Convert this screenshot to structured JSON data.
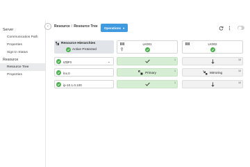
{
  "sidebar": {
    "groups": [
      {
        "label": "Server",
        "items": [
          {
            "label": "Communication Path"
          },
          {
            "label": "Properties"
          },
          {
            "label": "Sign-in Status"
          }
        ]
      },
      {
        "label": "Resource",
        "items": [
          {
            "label": "Resource Tree"
          },
          {
            "label": "Properties"
          }
        ]
      }
    ],
    "collapse_glyph": "‹"
  },
  "topbar": {
    "breadcrumb": [
      "Resource",
      "Resource Tree"
    ],
    "breadcrumb_sep": "/",
    "operations_label": "Operations",
    "operations_caret": "▾"
  },
  "hierarchy": {
    "title": "Resource Hierarchies",
    "status": "Active Protected"
  },
  "nodes": [
    {
      "name": "LK001",
      "extra": ""
    },
    {
      "name": "LK002",
      "extra": ""
    }
  ],
  "resources": [
    {
      "label": "IZ$F0",
      "expand": "⌄"
    },
    {
      "label": "lnx.0",
      "expand": ""
    },
    {
      "label": "ip-10.1.0.100",
      "expand": ""
    }
  ],
  "cells": {
    "row0": [
      {
        "text": "",
        "state": "active",
        "priority": "1"
      },
      {
        "text": "",
        "state": "standby",
        "priority": "10"
      }
    ],
    "row1": [
      {
        "text": "Primary",
        "state": "active",
        "priority": "1"
      },
      {
        "text": "Mirroring",
        "state": "standby",
        "priority": "10"
      }
    ],
    "row2": [
      {
        "text": "",
        "state": "active",
        "priority": "1"
      },
      {
        "text": "",
        "state": "standby",
        "priority": "10"
      }
    ]
  },
  "colors": {
    "active_fill": "#d6eed4",
    "ok_green": "#4caf50",
    "ops_button": "#3f9ae0"
  }
}
